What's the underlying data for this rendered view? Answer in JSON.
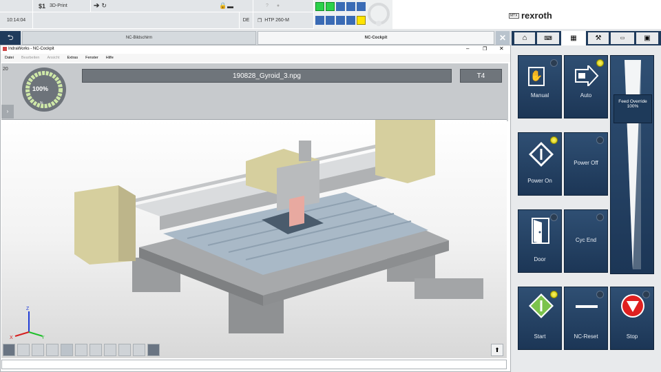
{
  "status": {
    "program_slot": "$1",
    "program_name": "3D-Print",
    "time": "10:14:04",
    "language": "DE",
    "machine": "HTP 260-M"
  },
  "brand": {
    "badge": "MTX",
    "name": "rexroth"
  },
  "tabs": [
    {
      "label": "NC-Bildschirm"
    },
    {
      "label": "NC-Cockpit"
    }
  ],
  "window": {
    "title": "IndraWorks - NC-Cockpit"
  },
  "menu": [
    "Datei",
    "Bearbeiten",
    "Ansicht",
    "Extras",
    "Fenster",
    "Hilfe"
  ],
  "gauge": {
    "value_label": "100%",
    "number": "20",
    "unit": "%",
    "fraction": 1.0
  },
  "file_label": "190828_Gyroid_3.npg",
  "tool_label": "T4",
  "buttons": [
    {
      "label": "Manual",
      "icon": "hand-icon",
      "led": "off"
    },
    {
      "label": "Auto",
      "icon": "auto-arrow-icon",
      "led": "on"
    },
    {
      "label": "Power On",
      "icon": "power-on-icon",
      "led": "on"
    },
    {
      "label": "Power Off",
      "icon": "",
      "led": "off"
    },
    {
      "label": "Door",
      "icon": "door-icon",
      "led": "off"
    },
    {
      "label": "Cyc End",
      "icon": "",
      "led": "off"
    },
    {
      "label": "Start",
      "icon": "start-icon",
      "led": "on"
    },
    {
      "label": "NC-Reset",
      "icon": "reset-icon",
      "led": "off"
    },
    {
      "label": "Stop",
      "icon": "stop-icon",
      "led": "off"
    }
  ],
  "feed": {
    "label": "Feed Override",
    "value": "100%",
    "fraction": 1.0
  },
  "colors": {
    "accent_blue": "#1f3b5c",
    "led_on": "#e8e000",
    "status_green": "#2bd14a"
  }
}
